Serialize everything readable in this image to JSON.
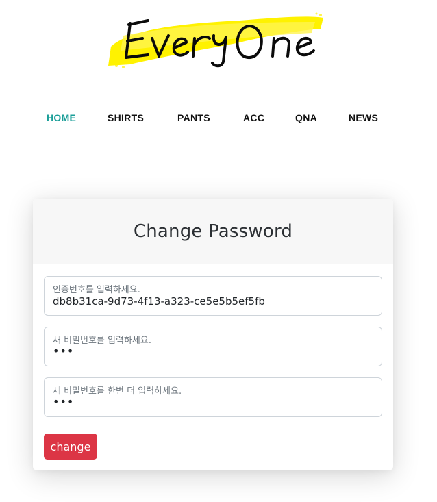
{
  "brand": {
    "logo_text": "EveryOne",
    "highlight_color": "#fff200"
  },
  "nav": {
    "items": [
      {
        "label": "HOME",
        "active": true
      },
      {
        "label": "SHIRTS",
        "active": false
      },
      {
        "label": "PANTS",
        "active": false
      },
      {
        "label": "ACC",
        "active": false
      },
      {
        "label": "QNA",
        "active": false
      },
      {
        "label": "NEWS",
        "active": false
      }
    ],
    "active_color": "#1a9e98"
  },
  "card": {
    "title": "Change Password",
    "fields": [
      {
        "label": "인증번호를 입력하세요.",
        "value": "db8b31ca-9d73-4f13-a323-ce5e5b5ef5fb"
      },
      {
        "label": "새 비밀번호를 입력하세요.",
        "value": "•••"
      },
      {
        "label": "새 비밀번호를 한번 더 입력하세요.",
        "value": "•••"
      }
    ],
    "submit_label": "change",
    "submit_color": "#dc3545"
  }
}
